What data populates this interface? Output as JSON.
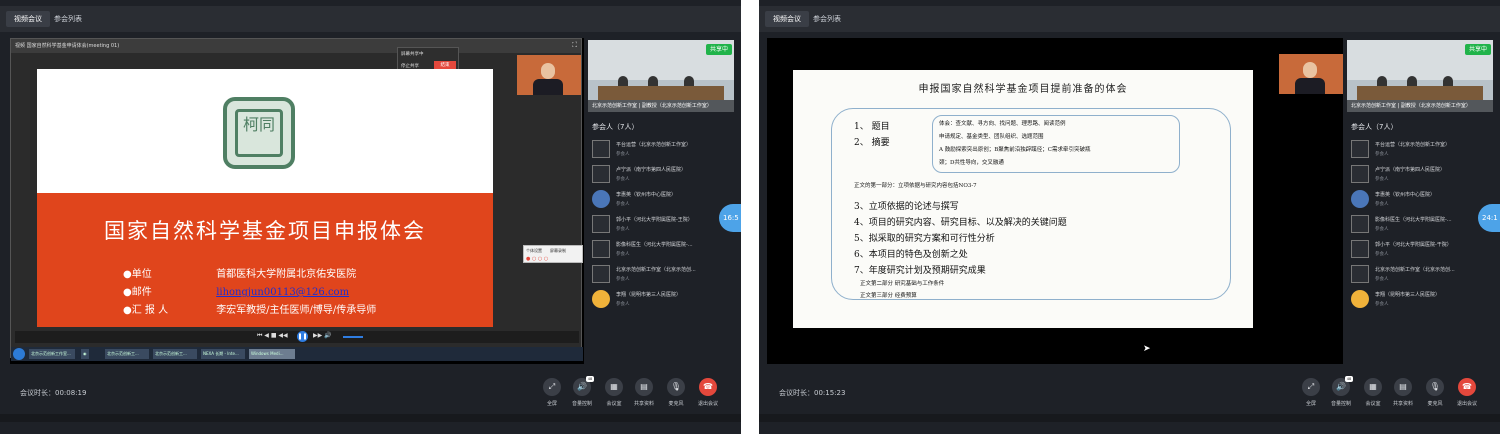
{
  "tabs": {
    "meeting": "视频会议",
    "list": "参会列表"
  },
  "left": {
    "window_title": "视频 国家自然科学基金申请体会(meeting 01)",
    "popup": {
      "title": "屏幕共享中",
      "item": "停止共享",
      "btn": "结束"
    },
    "mini_popup": {
      "a": "个体设置",
      "b": "屏幕录制"
    },
    "slide": {
      "seal_text": "柯同",
      "title": "国家自然科学基金项目申报体会",
      "rows": [
        {
          "key": "●单位",
          "value": "首都医科大学附属北京佑安医院"
        },
        {
          "key": "●邮件",
          "value": "lihongjun00113@126.com"
        },
        {
          "key": "●汇 报 人",
          "value": "李宏军教授/主任医师/博导/传承导师"
        }
      ]
    },
    "taskbar": [
      "北京示范创新工作室...",
      "北京示范创新工...",
      "北京示范创新工...",
      "NEXA 长期 - Inte...",
      "Windows Medi..."
    ],
    "timer": "16:5",
    "duration_label": "会议时长：",
    "duration": "00:08:19"
  },
  "right": {
    "slide": {
      "title": "申报国家自然科学基金项目提前准备的体会",
      "items_top": [
        "1、 题目",
        "2、 摘要"
      ],
      "inner": [
        "体会：查文献、寻方向、找问题、理思路、阅读范例",
        "申请规定、基金类型、团队组织、选题范围",
        "A 鼓励探索突出原创；B聚焦前沿独辟蹊径；C需求牵引突破瓶",
        "颈；D共性导向，交叉融通"
      ],
      "part1": "正文的第一部分：立项依据与研究内容包括NO3-7",
      "items": [
        "3、立项依据的论述与撰写",
        "4、项目的研究内容、研究目标、以及解决的关键问题",
        "5、拟采取的研究方案和可行性分析",
        "6、本项目的特色及创新之处",
        "7、年度研究计划及预期研究成果"
      ],
      "part2": "正文第二部分 研究基础与工作条件",
      "part3": "正文第三部分 经费预算"
    },
    "timer": "24:1",
    "duration_label": "会议时长：",
    "duration": "00:15:23"
  },
  "sidebar": {
    "share_badge": "共享中",
    "room_caption": "北京示范创新工作室 | 副教授（北京示范创新工作室）",
    "participants_title": "参会人（7人）",
    "participants": [
      {
        "name": "平台运营（北京示范创新工作室）",
        "role": "参会人"
      },
      {
        "name": "卢宁派（南宁市第四人民医院）",
        "role": "参会人"
      },
      {
        "name": "李惠英（钦州市中心医院）",
        "role": "参会人"
      },
      {
        "name": "郭小平（河北大学附属医院-王院）",
        "role": "参会人"
      },
      {
        "name": "影像科医生（河北大学附属医院-...",
        "role": "参会人"
      },
      {
        "name": "北京示范创新工作室（北京示范创...",
        "role": "参会人"
      },
      {
        "name": "李翔（昆明市第三人民医院）",
        "role": "参会人"
      }
    ],
    "participants_right": [
      {
        "name": "平台运营（北京示范创新工作室）",
        "role": "参会人"
      },
      {
        "name": "卢宁派（南宁市第四人民医院）",
        "role": "参会人"
      },
      {
        "name": "李惠英（钦州市中心医院）",
        "role": "参会人"
      },
      {
        "name": "影像科医生（河北大学附属医院-...",
        "role": "参会人"
      },
      {
        "name": "郭小平（河北大学附属医院-干院）",
        "role": "参会人"
      },
      {
        "name": "北京示范创新工作室（北京示范创...",
        "role": "参会人"
      },
      {
        "name": "李翔（昆明市第三人民医院）",
        "role": "参会人"
      }
    ]
  },
  "controls": {
    "fullscreen": "全屏",
    "volume": "音量控制",
    "volume_badge": "48",
    "meeting_room": "会议室",
    "share": "共享资料",
    "mic": "麦克风",
    "leave": "退出会议"
  },
  "colors": {
    "accent_orange": "#e0451c",
    "share_green": "#20b34a",
    "leave_red": "#e4483c",
    "timer_blue": "#4da3e8"
  }
}
